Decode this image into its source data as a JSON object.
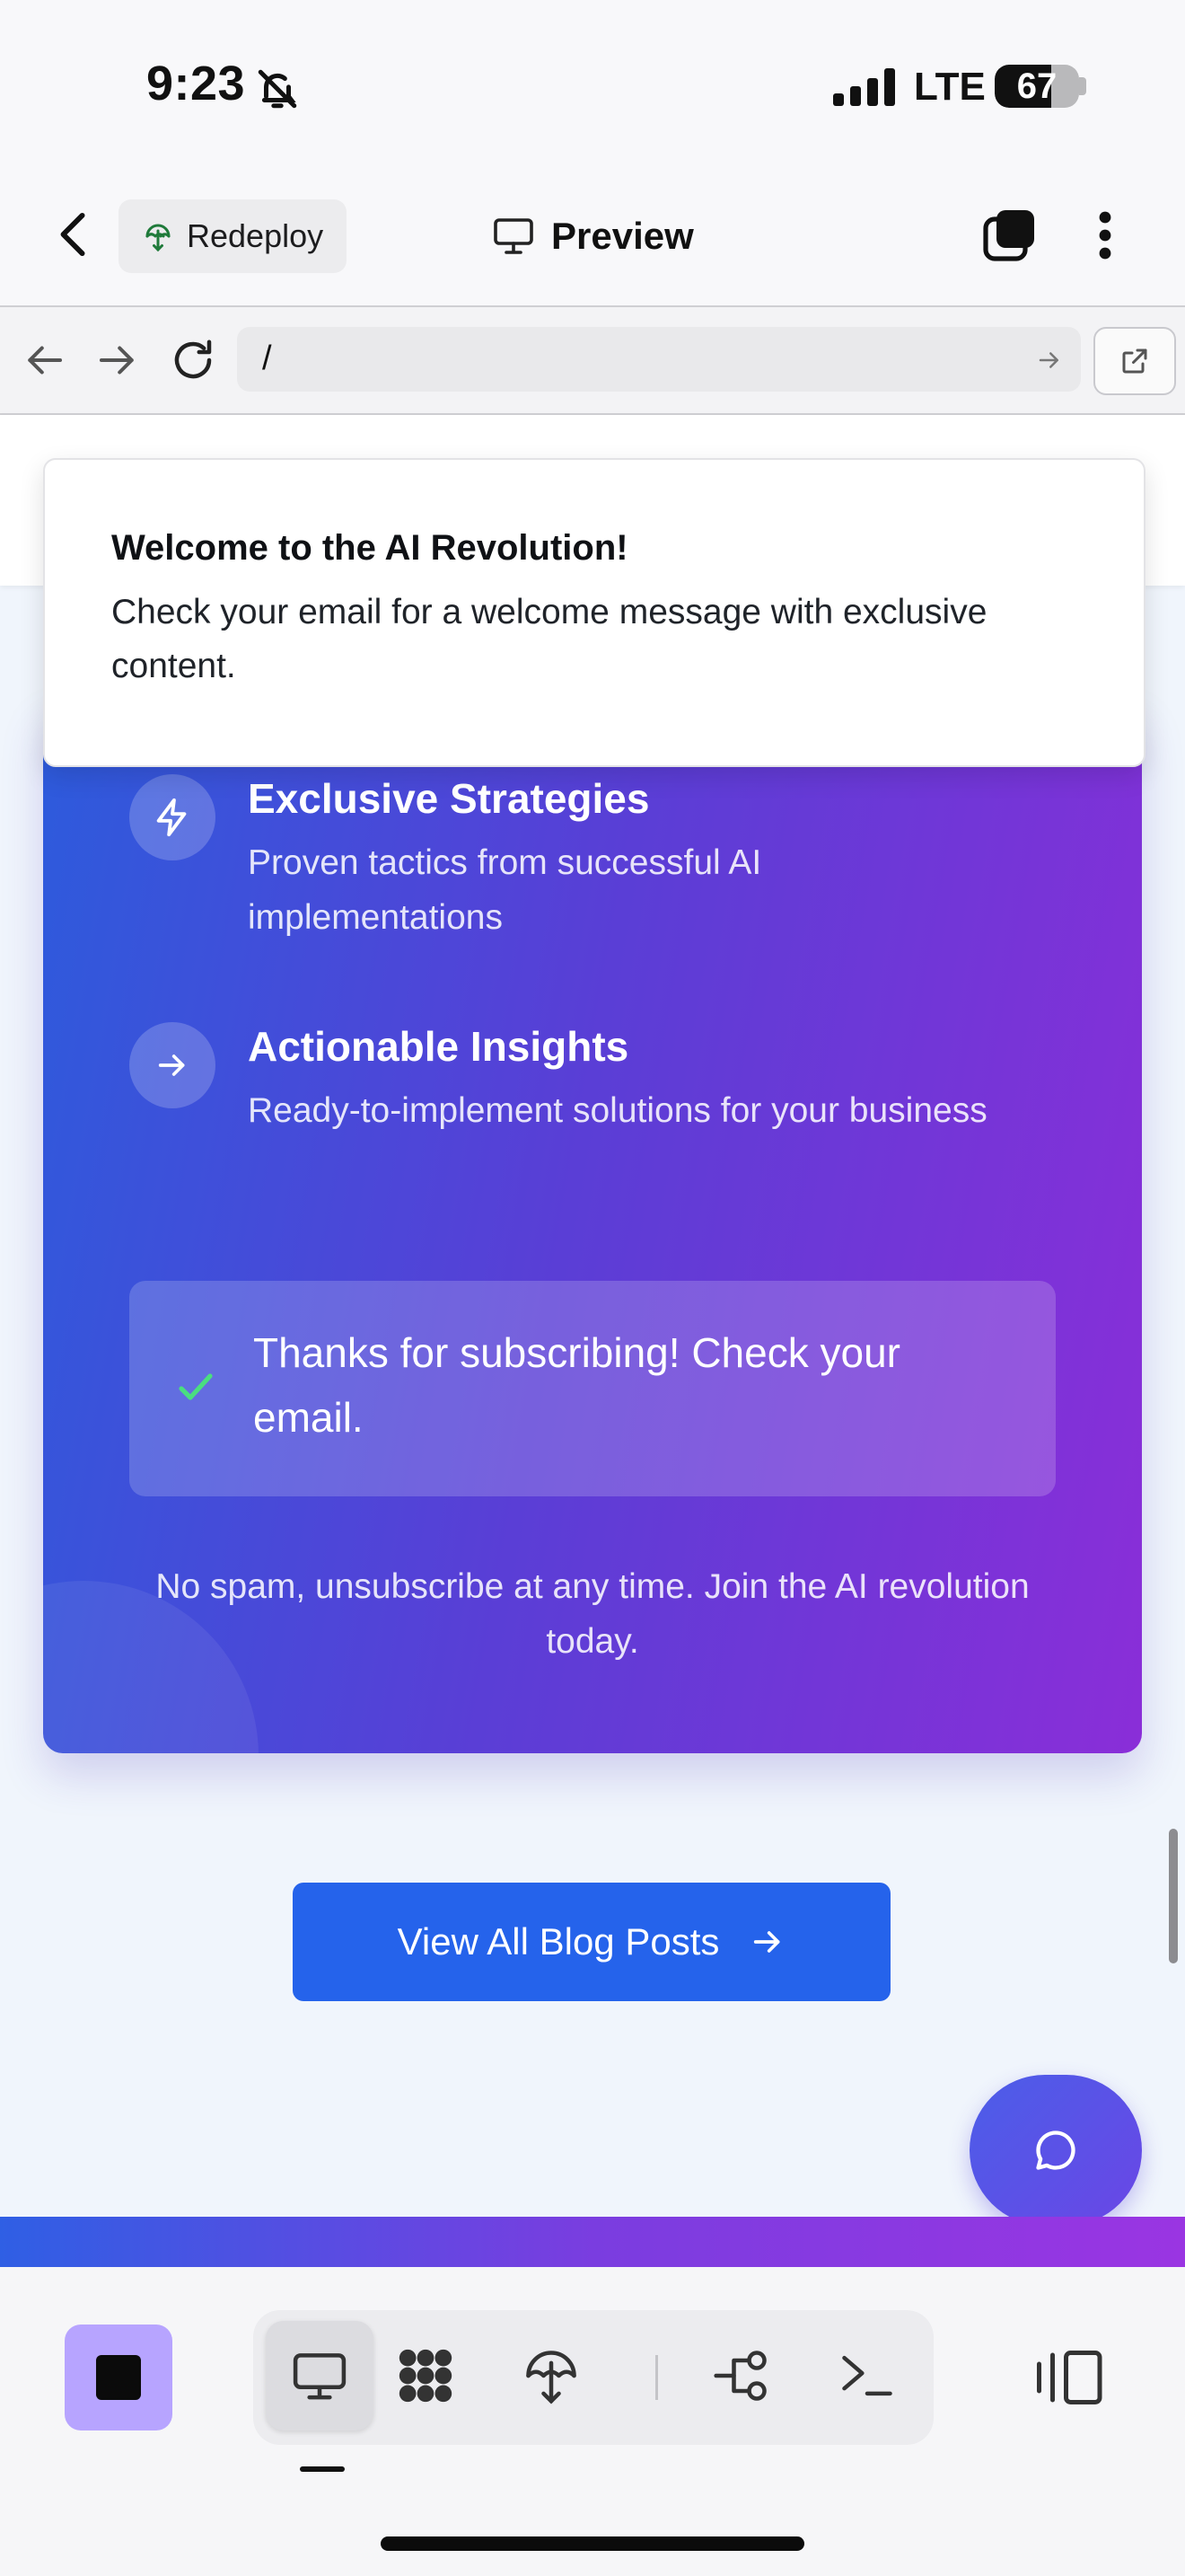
{
  "status_bar": {
    "time": "9:23",
    "network": "LTE",
    "battery": "67",
    "battery_level": 0.67
  },
  "app_toolbar": {
    "back_icon": "chevron-left-icon",
    "redeploy_label": "Redeploy",
    "title": "Preview",
    "title_icon": "monitor-icon"
  },
  "browser": {
    "url": "/"
  },
  "toast": {
    "title": "Welcome to the AI Revolution!",
    "body": "Check your email for a welcome message with exclusive content."
  },
  "newsletter": {
    "features": [
      {
        "icon": "lightning-icon",
        "title": "Exclusive Strategies",
        "description": "Proven tactics from successful AI implementations"
      },
      {
        "icon": "arrow-right-icon",
        "title": "Actionable Insights",
        "description": "Ready-to-implement solutions for your business"
      }
    ],
    "success_message": "Thanks for subscribing! Check your email.",
    "fine_print": "No spam, unsubscribe at any time. Join the AI revolution today."
  },
  "blog_button": {
    "label": "View All Blog Posts"
  },
  "colors": {
    "accent": "#2563eb",
    "card_gradient_start": "#2d5bdc",
    "card_gradient_end": "#8a2ed8",
    "success_check": "#4ade80",
    "stop_button": "#b7a4ff"
  },
  "dock": {
    "tools": [
      "desktop-icon",
      "grid-icon",
      "deploy-icon",
      "branch-icon",
      "terminal-icon"
    ],
    "active_tool": "desktop-icon"
  }
}
